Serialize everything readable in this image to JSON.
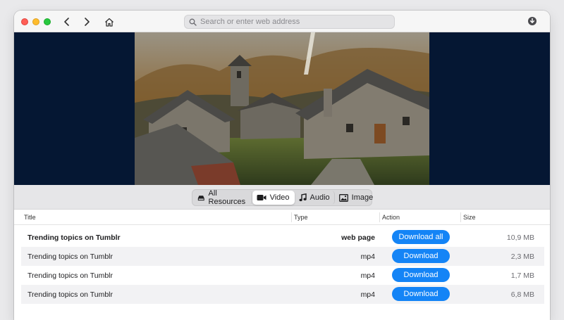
{
  "toolbar": {
    "address_placeholder": "Search or enter web address"
  },
  "icons": {
    "back": "chevron-left-icon",
    "forward": "chevron-right-icon",
    "home": "home-icon",
    "search": "magnifier-icon",
    "download": "download-circle-icon"
  },
  "tabs": [
    {
      "label": "All Resources",
      "icon": "hard-drive-icon",
      "active": false
    },
    {
      "label": "Video",
      "icon": "video-camera-icon",
      "active": true
    },
    {
      "label": "Audio",
      "icon": "music-note-icon",
      "active": false
    },
    {
      "label": "Image",
      "icon": "photo-icon",
      "active": false
    }
  ],
  "table": {
    "columns": [
      "Title",
      "Type",
      "Action",
      "Size"
    ],
    "rows": [
      {
        "title": "Trending topics on Tumblr",
        "type": "web page",
        "action": "Download all",
        "size": "10,9 MB"
      },
      {
        "title": "Trending topics on Tumblr",
        "type": "mp4",
        "action": "Download",
        "size": "2,3 MB"
      },
      {
        "title": "Trending topics on Tumblr",
        "type": "mp4",
        "action": "Download",
        "size": "1,7 MB"
      },
      {
        "title": "Trending topics on Tumblr",
        "type": "mp4",
        "action": "Download",
        "size": "6,8 MB"
      }
    ]
  },
  "colors": {
    "accent": "#1484f6",
    "media_background": "#051733",
    "close": "#ff5f57",
    "minimize": "#febc2e",
    "maximize": "#28c840"
  }
}
